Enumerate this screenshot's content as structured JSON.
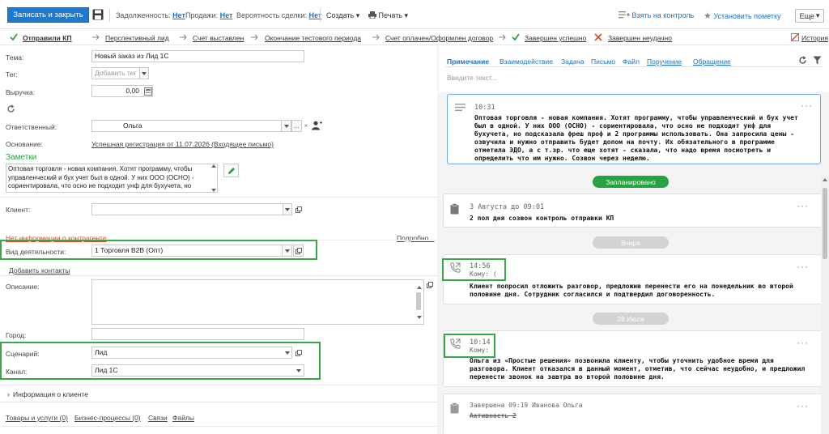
{
  "toolbar": {
    "save_close": "Записать и закрыть",
    "debt_label": "Задолженность:",
    "debt_value": "Нет",
    "sales_label": "Продажи:",
    "sales_value": "Нет",
    "prob_label": "Вероятность сделки:",
    "prob_value": "Нет",
    "create": "Создать",
    "print": "Печать",
    "take_control": "Взять на контроль",
    "set_mark": "Установить пометку",
    "more": "Еще"
  },
  "stages": [
    {
      "label": "Отправили КП",
      "active": true
    },
    {
      "label": "Перспективный лид"
    },
    {
      "label": "Счет выставлен"
    },
    {
      "label": "Окончание тестового периода"
    },
    {
      "label": "Счет оплачен/Оформлен договор"
    },
    {
      "label": "Завершен успешно"
    },
    {
      "label": "Завершен неудачно"
    },
    {
      "label": "История"
    }
  ],
  "form": {
    "theme_label": "Тема:",
    "theme_value": "Новый заказ из Лид 1С",
    "tag_label": "Тег:",
    "tag_placeholder": "Добавить тег",
    "revenue_label": "Выручка:",
    "revenue_value": "0,00",
    "responsible_label": "Ответственный:",
    "responsible_value": "Ольга",
    "basis_label": "Основание:",
    "basis_value": "Успешная регистрация от 11.07.2026 (Входящее письмо)",
    "notes_title": "Заметки",
    "notes_text": "Оптовая торговля - новая компания. Хотят программу, чтобы управленческий и бух учет был в одной. У них ООО (ОСНО) - сориентировала, что осно не подходит унф для бухучета, но",
    "client_label": "Клиент:",
    "no_info": "Нет информации о контрагенте",
    "more_link": "Подробно...",
    "activity_label": "Вид деятельности:",
    "activity_value": "1 Торговля B2B (Опт)",
    "add_contacts": "Добавить контакты",
    "description_label": "Описание:",
    "city_label": "Город:",
    "scenario_label": "Сценарий:",
    "scenario_value": "Лид",
    "channel_label": "Канал:",
    "channel_value": "Лид 1С",
    "client_info": "Информация о клиенте",
    "bottom_links": [
      "Товары и услуги (0)",
      "Бизнес-процессы (0)",
      "Связи",
      "Файлы"
    ]
  },
  "right": {
    "tabs": [
      "Примечание",
      "Взаимодействие",
      "Задача",
      "Письмо",
      "Файл",
      "Поручение",
      "Обращение"
    ],
    "input_placeholder": "Введите текст...",
    "note_time": "10:31",
    "note_text": "Оптовая торговля - новая компания. Хотят программу, чтобы управленческий и бух учет был в одной. У них ООО (ОСНО) - сориентировала, что осно не подходит унф для бухучета, но подсказала фреш проф и 2 программы использовать. Она запросила цены - озвучила и нужно отправить будет допом на почту. Их обязательного в программе отметила ЭДО, а с т.зр. что еще хотят - сказала, что надо время посмотреть и определить что им нужно. Созвон через неделю.",
    "planned": "Запланировано",
    "task_date": "3 Августа до 09:01",
    "task_text": "2 пол дня созвон контроль отправки КП",
    "yesterday": "Вчера",
    "call1_time": "14:56",
    "call1_to": "Кому: (",
    "call1_text": "Клиент попросил отложить разговор, предложив перенести его на понедельник во второй половине дня. Сотрудник согласился и подтвердил договоренность.",
    "date2": "28 Июля",
    "call2_time": "10:14",
    "call2_to": "Кому:",
    "call2_text": "Ольга из «Простые решения» позвонила клиенту, чтобы уточнить удобное время для разговора. Клиент отказался в данный момент, отметив, что сейчас неудобно, и предложил перенести звонок на завтра во второй половине дня.",
    "done_text": "Завершена 09:19 Иванова Ольга",
    "activity2": "Активность 2"
  },
  "colors": {
    "primary": "#1e7ad1",
    "green": "#27a243",
    "highlight": "#3aa64a",
    "link": "#1a73c8"
  }
}
